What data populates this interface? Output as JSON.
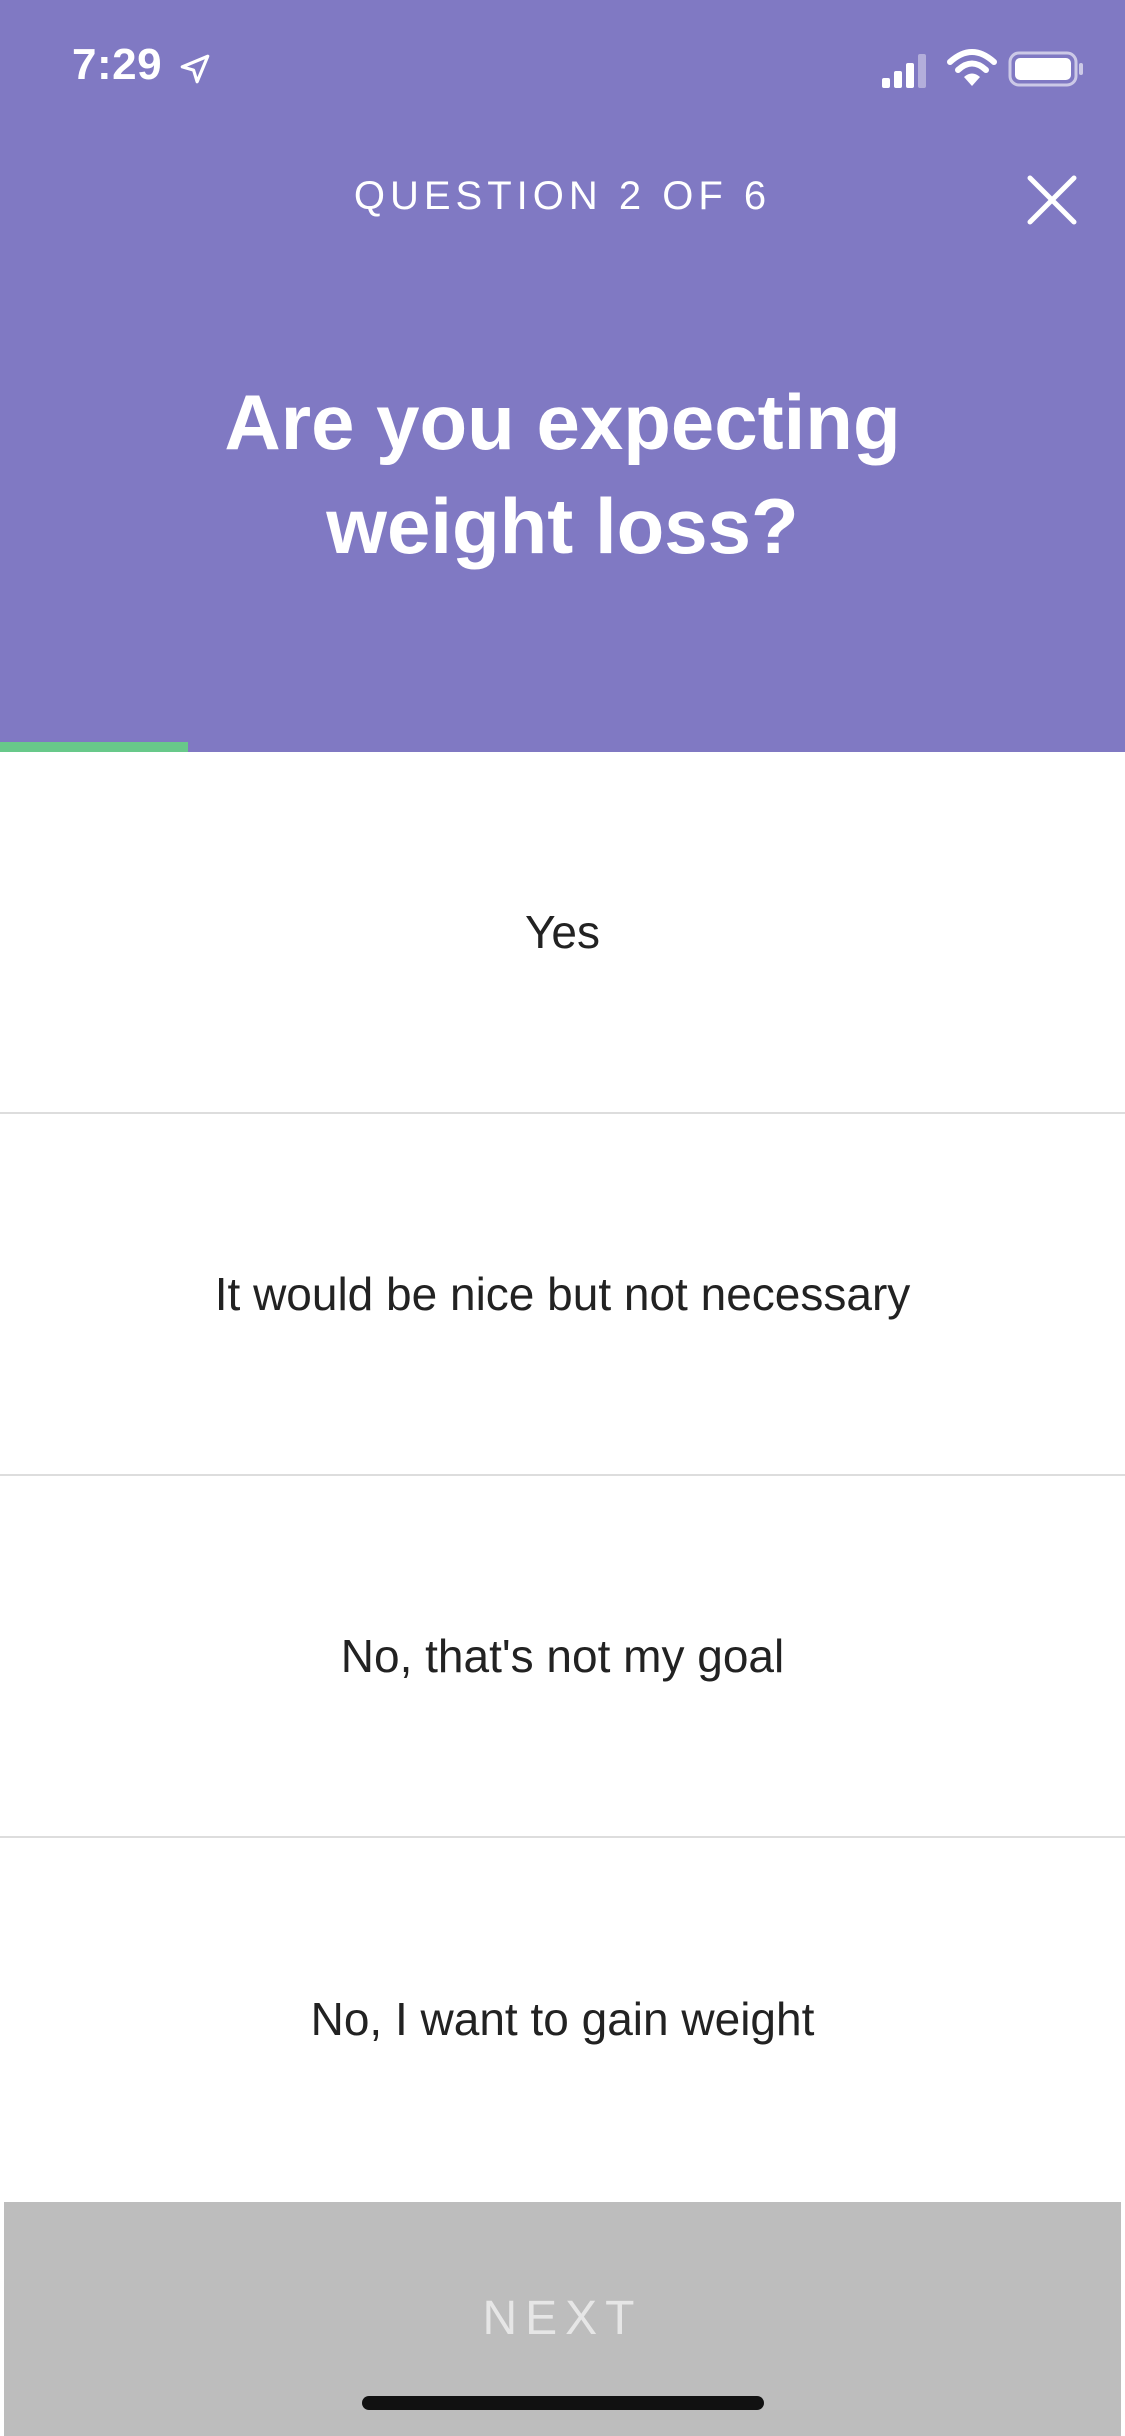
{
  "status_bar": {
    "time": "7:29"
  },
  "header": {
    "question_counter": "QUESTION 2 OF 6",
    "title": "Are you expecting weight loss?",
    "close_icon": "close-icon",
    "background_color": "#8079c3"
  },
  "progress": {
    "fraction": 0.167,
    "color": "#68c98a"
  },
  "options": [
    {
      "label": "Yes"
    },
    {
      "label": "It would be nice but not necessary"
    },
    {
      "label": "No, that's not my goal"
    },
    {
      "label": "No, I want to gain weight"
    }
  ],
  "footer": {
    "next_label": "NEXT",
    "next_state": "disabled"
  }
}
